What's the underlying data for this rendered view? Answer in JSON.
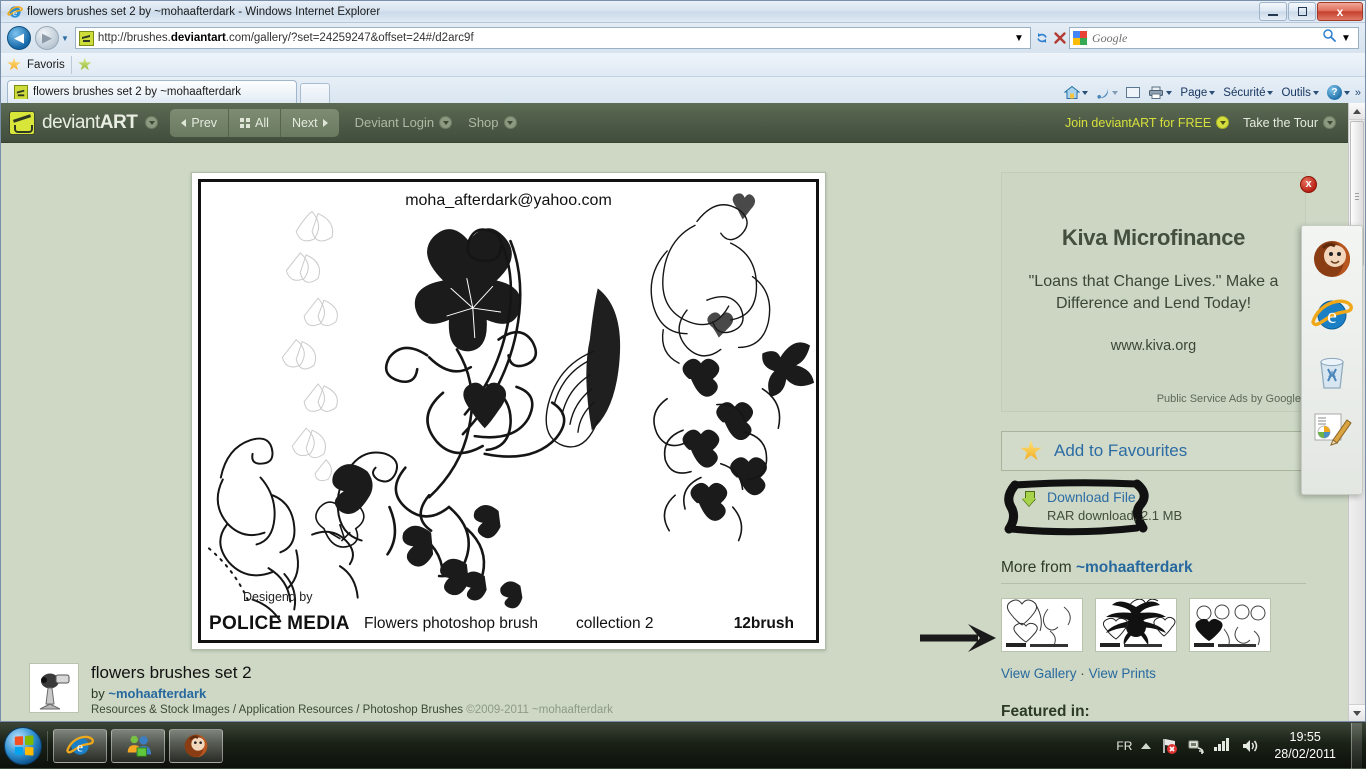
{
  "window": {
    "title": "flowers brushes set 2 by ~mohaafterdark - Windows Internet Explorer",
    "minimize_label": "Minimize",
    "restore_label": "Restore",
    "close_label": "x"
  },
  "browser": {
    "address": {
      "scheme": "http://",
      "host_pre": "brushes.",
      "host_bold": "deviantart",
      "host_post": ".com",
      "path": "/gallery/?set=24259247&offset=24#/d2arc9f",
      "full": "http://brushes.deviantart.com/gallery/?set=24259247&offset=24#/d2arc9f"
    },
    "search_placeholder": "Google",
    "back_label": "Back",
    "forward_label": "Forward",
    "history_label": "Recent Pages",
    "refresh_label": "Refresh",
    "stop_label": "Stop",
    "favorites_bar_label": "Favoris",
    "tab_title": "flowers brushes set 2 by ~mohaafterdark",
    "new_tab_label": "New Tab",
    "command_bar": [
      {
        "label": "",
        "icon": "home-icon",
        "has_caret": true
      },
      {
        "label": "",
        "icon": "feed-icon",
        "has_caret": true
      },
      {
        "label": "",
        "icon": "mail-icon",
        "has_caret": false
      },
      {
        "label": "",
        "icon": "print-icon",
        "has_caret": true
      },
      {
        "label": "Page",
        "icon": "",
        "has_caret": true
      },
      {
        "label": "Sécurité",
        "icon": "",
        "has_caret": true
      },
      {
        "label": "Outils",
        "icon": "",
        "has_caret": true
      },
      {
        "label": "",
        "icon": "help-icon",
        "has_caret": true
      }
    ],
    "overflow_label": "»"
  },
  "site_header": {
    "brand_light": "deviant",
    "brand_bold": "ART",
    "nav": [
      {
        "label": "Prev",
        "icon": "caret-left-icon"
      },
      {
        "label": "All",
        "icon": "grid-icon"
      },
      {
        "label": "Next",
        "icon": "caret-right-icon"
      }
    ],
    "menus": [
      {
        "label": "Deviant Login"
      },
      {
        "label": "Shop"
      }
    ],
    "join_label": "Join deviantART for FREE",
    "tour_label": "Take the Tour"
  },
  "artwork": {
    "email": "moha_afterdark@yahoo.com",
    "designed_by": "Desigend by",
    "studio": "POLICE MEDIA",
    "subtitle": "Flowers photoshop brush",
    "collection": "collection 2",
    "count": "12brush"
  },
  "deviation_info": {
    "title": "flowers brushes set 2",
    "by_prefix": "by",
    "author": "~mohaafterdark",
    "breadcrumbs": "Resources & Stock Images / Application Resources / Photoshop Brushes",
    "copyright": "©2009-2011 ~mohaafterdark"
  },
  "sidebar": {
    "ad": {
      "title": "Kiva Microfinance",
      "body": "\"Loans that Change Lives.\" Make a Difference and Lend Today!",
      "url": "www.kiva.org",
      "credit": "Public Service Ads by Google",
      "close_label": "x"
    },
    "favourites_button": "Add to Favourites",
    "download": {
      "title": "Download File",
      "meta": "RAR download, 2.1 MB"
    },
    "more_from_prefix": "More from",
    "more_from_author": "~mohaafterdark",
    "view_gallery": "View Gallery",
    "view_separator": "·",
    "view_prints": "View Prints",
    "featured_in": "Featured in:"
  },
  "taskbar": {
    "start_label": "Start",
    "buttons": [
      {
        "name": "internet-explorer",
        "label": "Internet Explorer"
      },
      {
        "name": "messenger",
        "label": "Windows Live Messenger"
      },
      {
        "name": "download-manager",
        "label": "Download Manager"
      }
    ],
    "tray": {
      "language": "FR",
      "time": "19:55",
      "date": "28/02/2011"
    }
  },
  "gadget_panel": {
    "icons": [
      "mascot-icon",
      "internet-explorer-icon",
      "recycle-bin-icon",
      "notepad-icon"
    ]
  },
  "colors": {
    "site_bg": "#ced8c5",
    "header_green": "#4b5845",
    "link_blue": "#27699e",
    "join_yellow": "#d6e03c",
    "ad_bg": "#ccd6c3"
  }
}
